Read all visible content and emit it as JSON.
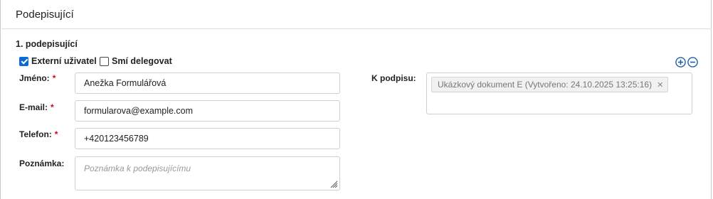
{
  "panel": {
    "title": "Podepisující"
  },
  "signer": {
    "heading": "1. podepisující",
    "external_user": {
      "label": "Externí uživatel",
      "checked": true
    },
    "may_delegate": {
      "label": "Smí delegovat",
      "checked": false
    },
    "fields": {
      "name": {
        "label": "Jméno:",
        "required_mark": "*",
        "value": "Anežka Formulářová"
      },
      "email": {
        "label": "E-mail:",
        "required_mark": "*",
        "value": "formularova@example.com"
      },
      "phone": {
        "label": "Telefon:",
        "required_mark": "*",
        "value": "+420123456789"
      },
      "note": {
        "label": "Poznámka:",
        "value": "",
        "placeholder": "Poznámka k podepisujícímu"
      }
    },
    "to_sign": {
      "label": "K podpisu:",
      "selected": [
        {
          "text": "Ukázkový dokument E (Vytvořeno: 24.10.2025 13:25:16)",
          "remove": "✕"
        }
      ]
    }
  },
  "controls": {
    "add_icon": "plus-circle-icon",
    "remove_icon": "minus-circle-icon"
  },
  "colors": {
    "accent": "#0a6ad6",
    "required": "#d0021b",
    "icon_blue": "#1f5fa8"
  }
}
